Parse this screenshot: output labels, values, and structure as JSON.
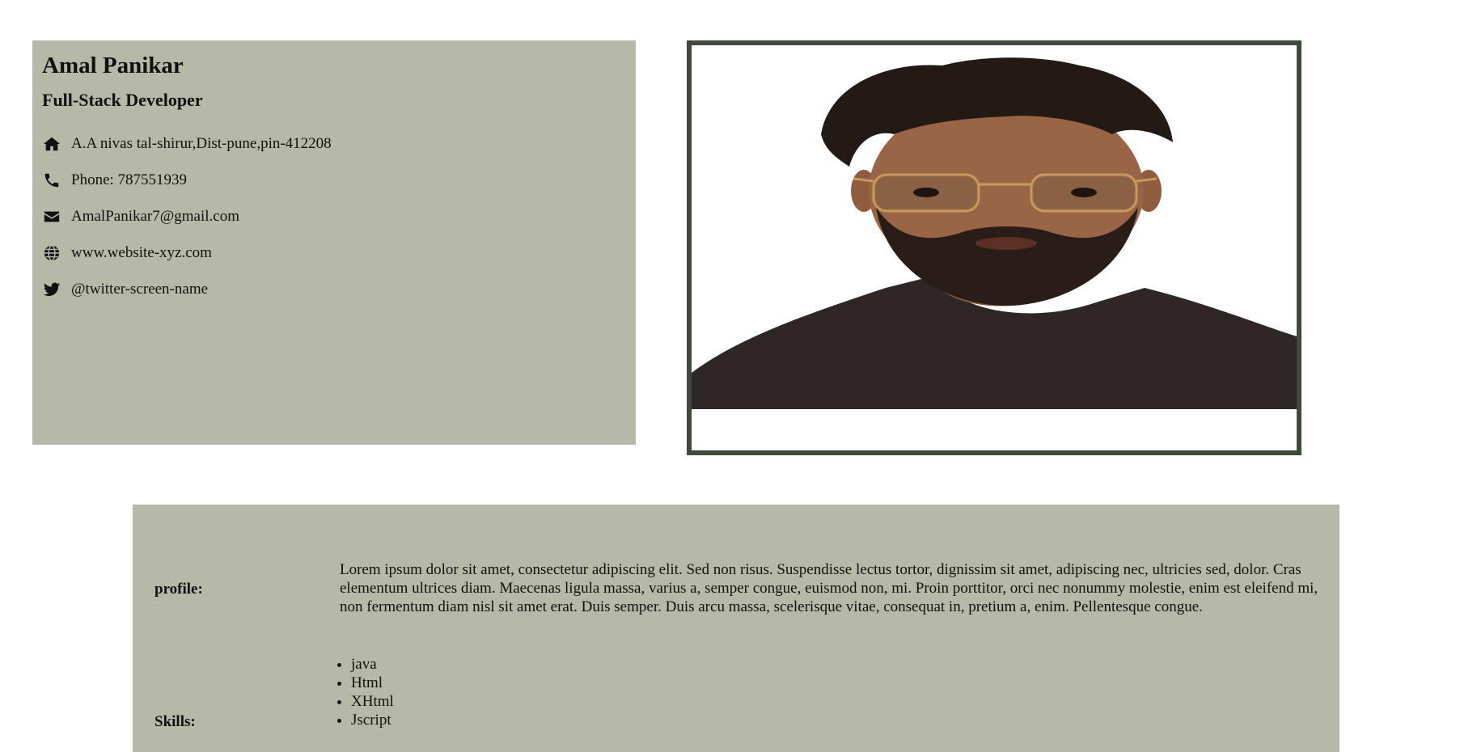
{
  "card": {
    "name": "Amal Panikar",
    "role": "Full-Stack Developer",
    "contacts": [
      {
        "icon": "home-icon",
        "text": "A.A nivas tal-shirur,Dist-pune,pin-412208"
      },
      {
        "icon": "phone-icon",
        "text": "Phone: 787551939"
      },
      {
        "icon": "envelope-icon",
        "text": "AmalPanikar7@gmail.com"
      },
      {
        "icon": "globe-icon",
        "text": "www.website-xyz.com"
      },
      {
        "icon": "twitter-icon",
        "text": "@twitter-screen-name"
      }
    ]
  },
  "photo": {
    "alt": "profile photo"
  },
  "details": {
    "profile_label": "profile:",
    "profile_text": "Lorem ipsum dolor sit amet, consectetur adipiscing elit. Sed non risus. Suspendisse lectus tortor, dignissim sit amet, adipiscing nec, ultricies sed, dolor. Cras elementum ultrices diam. Maecenas ligula massa, varius a, semper congue, euismod non, mi. Proin porttitor, orci nec nonummy molestie, enim est eleifend mi, non fermentum diam nisl sit amet erat. Duis semper. Duis arcu massa, scelerisque vitae, consequat in, pretium a, enim. Pellentesque congue.",
    "skills_label": "Skills:",
    "skills": [
      "java",
      "Html",
      "XHtml",
      "Jscript"
    ]
  },
  "colors": {
    "panel": "#b6b8a8",
    "frame": "#3f4a3c"
  }
}
